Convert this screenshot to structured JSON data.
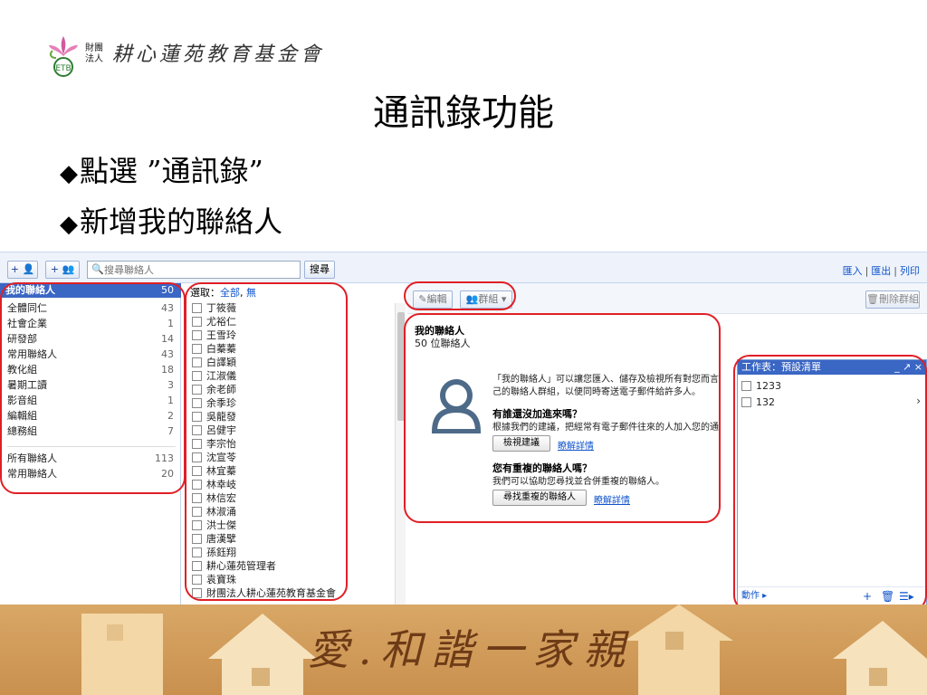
{
  "slide": {
    "org_small": "財團 法人",
    "org_name": "耕心蓮苑教育基金會",
    "title": "通訊錄功能",
    "bullets": [
      "點選 ”通訊錄”",
      "新增我的聯絡人"
    ],
    "bullet_glyph": "◆",
    "slogan": "愛.和諧一家親"
  },
  "toolbar": {
    "add_contact": "+ 👤",
    "add_group": "+ 👥",
    "search_placeholder": "搜尋聯絡人",
    "search_button": "搜尋",
    "links": [
      "匯入",
      "匯出",
      "列印"
    ]
  },
  "groups": {
    "header": "我的聯絡人",
    "header_count": "50",
    "items": [
      {
        "label": "全體同仁",
        "count": "43"
      },
      {
        "label": "社會企業",
        "count": "1"
      },
      {
        "label": "研發部",
        "count": "14"
      },
      {
        "label": "常用聯絡人",
        "count": "43"
      },
      {
        "label": "教化組",
        "count": "18"
      },
      {
        "label": "暑期工讀",
        "count": "3"
      },
      {
        "label": "影音組",
        "count": "1"
      },
      {
        "label": "編輯組",
        "count": "2"
      },
      {
        "label": "總務組",
        "count": "7"
      }
    ],
    "bottom": [
      {
        "label": "所有聯絡人",
        "count": "113"
      },
      {
        "label": "常用聯絡人",
        "count": "20"
      }
    ]
  },
  "contacts": {
    "select_label": "選取：",
    "select_all": "全部",
    "select_none": "無",
    "names": [
      "丁筱薇",
      "尤裕仁",
      "王雪玲",
      "白蓁蓁",
      "白譯穎",
      "江淑儀",
      "余老師",
      "余季珍",
      "吳龍發",
      "呂健宇",
      "李宗怡",
      "沈宣苓",
      "林宜蓁",
      "林幸岐",
      "林信宏",
      "林淑涌",
      "洪士傑",
      "唐漢擘",
      "孫鈺翔",
      "耕心蓮苑管理者",
      "袁寶珠",
      "財團法人耕心蓮苑教育基金會"
    ]
  },
  "detail": {
    "edit_button": "編輯",
    "group_button": "群組 ▾",
    "delete_group_button": "刪除群組",
    "title": "我的聯絡人",
    "count_text": "50 位聯絡人",
    "intro_line1": "「我的聯絡人」可以讓您匯入、儲存及檢視所有對您而言",
    "intro_line2": "己的聯絡人群組，以便同時寄送電子郵件給許多人。",
    "q1": "有誰還沒加進來嗎？",
    "a1": "根據我們的建議，把經常有電子郵件往來的人加入您的通",
    "btn1": "檢視建議",
    "link1": "瞭解詳情",
    "q2": "您有重複的聯絡人嗎？",
    "a2": "我們可以協助您尋找並合併重複的聯絡人。",
    "btn2": "尋找重複的聯絡人",
    "link2": "瞭解詳情"
  },
  "tasks": {
    "header": "工作表：預設清單",
    "controls": "_ ↗ ×",
    "items": [
      "1233",
      "132"
    ],
    "chevron": "›",
    "footer_action": "動作 ▸",
    "footer_add": "+",
    "footer_delete": "🗑",
    "footer_list": "☰▸"
  },
  "colors": {
    "highlight": "#e01f26",
    "header_blue": "#3a66c4",
    "link": "#1155cc",
    "footer_wood": "#c9904e"
  }
}
